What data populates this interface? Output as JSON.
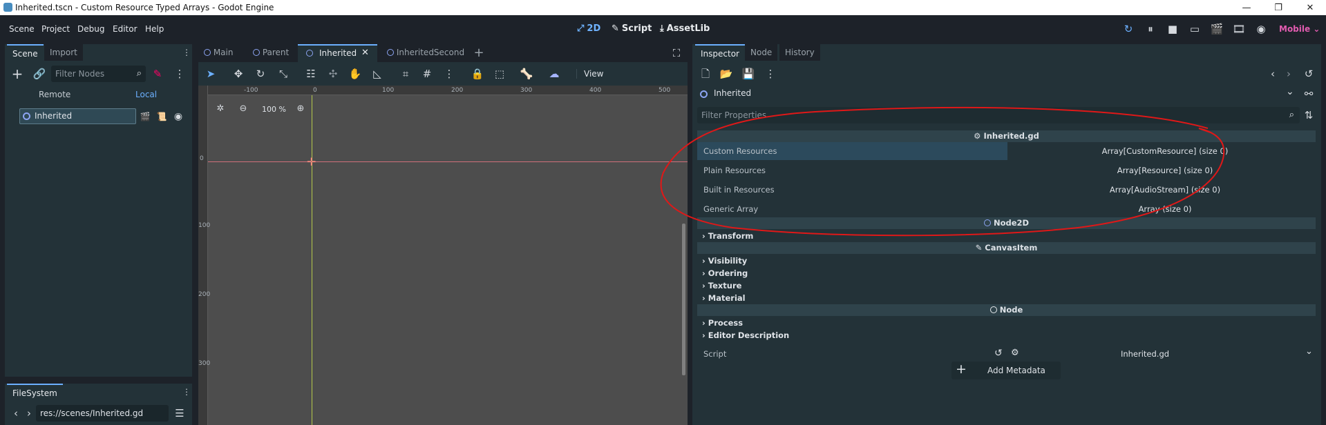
{
  "window": {
    "title": "Inherited.tscn - Custom Resource Typed Arrays - Godot Engine",
    "min": "—",
    "max": "❐",
    "close": "✕"
  },
  "menu": [
    "Scene",
    "Project",
    "Debug",
    "Editor",
    "Help"
  ],
  "workspaces": {
    "twod": "2D",
    "script": "Script",
    "assetlib": "AssetLib"
  },
  "renderer": "Mobile",
  "scene_panel": {
    "tabs": [
      "Scene",
      "Import"
    ],
    "filter_placeholder": "Filter Nodes",
    "remote": "Remote",
    "local": "Local",
    "node": "Inherited"
  },
  "filesystem": {
    "tab": "FileSystem",
    "path": "res://scenes/Inherited.gd"
  },
  "scene_tabs": [
    "Main",
    "Parent",
    "Inherited",
    "InheritedSecond"
  ],
  "toolbar": {
    "view": "View"
  },
  "viewport": {
    "zoom": "100 %",
    "ruler_h": [
      "-100",
      "0",
      "100",
      "200",
      "300",
      "400",
      "500"
    ],
    "ruler_v": [
      "0",
      "100",
      "200",
      "300"
    ]
  },
  "inspector": {
    "tabs": [
      "Inspector",
      "Node",
      "History"
    ],
    "object": "Inherited",
    "filter_placeholder": "Filter Properties",
    "script_section": "Inherited.gd",
    "props": [
      {
        "label": "Custom Resources",
        "value": "Array[CustomResource] (size 0)"
      },
      {
        "label": "Plain Resources",
        "value": "Array[Resource] (size 0)"
      },
      {
        "label": "Built in Resources",
        "value": "Array[AudioStream] (size 0)"
      },
      {
        "label": "Generic Array",
        "value": "Array (size 0)"
      }
    ],
    "node2d_section": "Node2D",
    "transform": "Transform",
    "canvasitem_section": "CanvasItem",
    "canvas_groups": [
      "Visibility",
      "Ordering",
      "Texture",
      "Material"
    ],
    "node_section": "Node",
    "node_groups": [
      "Process",
      "Editor Description"
    ],
    "script_label": "Script",
    "script_value": "Inherited.gd",
    "add_metadata": "Add Metadata"
  },
  "colors": {
    "accent": "#6cb0ff",
    "annotation": "#e01818",
    "panel": "#233238",
    "viewport": "#4d4d4d"
  }
}
